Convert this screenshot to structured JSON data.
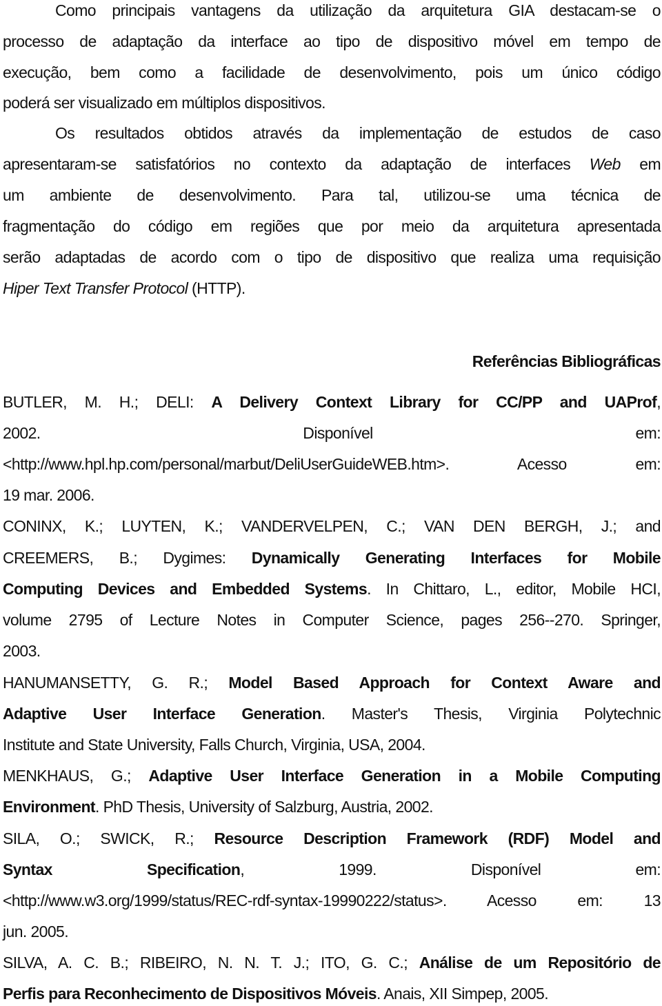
{
  "body_paragraphs": [
    {
      "lines": [
        "Como principais vantagens da utilização da arquitetura GIA destacam-se o",
        "processo de adaptação da interface ao tipo de dispositivo móvel em tempo de",
        "execução, bem como a facilidade de desenvolvimento, pois um único código",
        "poderá ser visualizado em múltiplos dispositivos."
      ]
    },
    {
      "lines": [
        "Os resultados obtidos através da implementação de estudos de caso",
        {
          "pre": "apresentaram-se satisfatórios no contexto da adaptação de interfaces ",
          "italic": "Web",
          "post": " em"
        },
        "um ambiente de desenvolvimento. Para tal, utilizou-se uma técnica de",
        "fragmentação do código em regiões que por meio da arquitetura apresentada",
        "serão adaptadas de acordo com o tipo de dispositivo que realiza uma requisição",
        {
          "pre": "",
          "italic": "Hiper Text Transfer Protocol",
          "post": " (HTTP)."
        }
      ]
    }
  ],
  "references_heading": "Referências Bibliográficas",
  "references": [
    {
      "lines": [
        {
          "pre": "BUTLER, M. H.; DELI: ",
          "bold": "A  Delivery Context Library for CC/PP and UAProf",
          "post": ","
        },
        {
          "pre": "2002. Disponível em:"
        },
        {
          "pre": "<http://www.hpl.hp.com/personal/marbut/DeliUserGuideWEB.htm>. Acesso em:"
        },
        {
          "pre": "19 mar. 2006."
        }
      ]
    },
    {
      "lines": [
        {
          "pre": "CONINX, K.; LUYTEN, K.; VANDERVELPEN, C.; VAN DEN BERGH, J.; and"
        },
        {
          "pre": "CREEMERS, B.; Dygimes: ",
          "bold": "Dynamically Generating Interfaces for Mobile",
          "post": ""
        },
        {
          "pre": "",
          "bold": "Computing Devices and Embedded Systems",
          "post": ". In Chittaro, L., editor, Mobile HCI,"
        },
        {
          "pre": "volume 2795 of Lecture Notes in Computer Science, pages 256--270. Springer,"
        },
        {
          "pre": "2003."
        }
      ]
    },
    {
      "lines": [
        {
          "pre": "HANUMANSETTY, G. R.; ",
          "bold": "Model Based Approach for Context Aware and",
          "post": ""
        },
        {
          "pre": "",
          "bold": "Adaptive User Interface Generation",
          "post": ". Master's Thesis, Virginia Polytechnic"
        },
        {
          "pre": "Institute and State University, Falls Church, Virginia, USA, 2004."
        }
      ]
    },
    {
      "lines": [
        {
          "pre": "MENKHAUS, G.; ",
          "bold": "Adaptive User Interface Generation in a Mobile Computing",
          "post": ""
        },
        {
          "pre": "",
          "bold": "Environment",
          "post": ". PhD Thesis, University of Salzburg, Austria, 2002."
        }
      ]
    },
    {
      "lines": [
        {
          "pre": "SILA, O.; SWICK, R.; ",
          "bold": "Resource Description Framework (RDF) Model and",
          "post": ""
        },
        {
          "pre": "",
          "bold": "Syntax Specification",
          "post": ", 1999. Disponível em:"
        },
        {
          "pre": "<http://www.w3.org/1999/status/REC-rdf-syntax-19990222/status>. Acesso em: 13"
        },
        {
          "pre": "jun. 2005."
        }
      ]
    },
    {
      "lines": [
        {
          "pre": "SILVA, A. C. B.; RIBEIRO, N. N. T. J.; ITO, G. C.; ",
          "bold": "Análise de um Repositório de",
          "post": ""
        },
        {
          "pre": "",
          "bold": "Perfis para Reconhecimento de Dispositivos Móveis",
          "post": ". Anais, XII Simpep, 2005."
        }
      ]
    }
  ]
}
